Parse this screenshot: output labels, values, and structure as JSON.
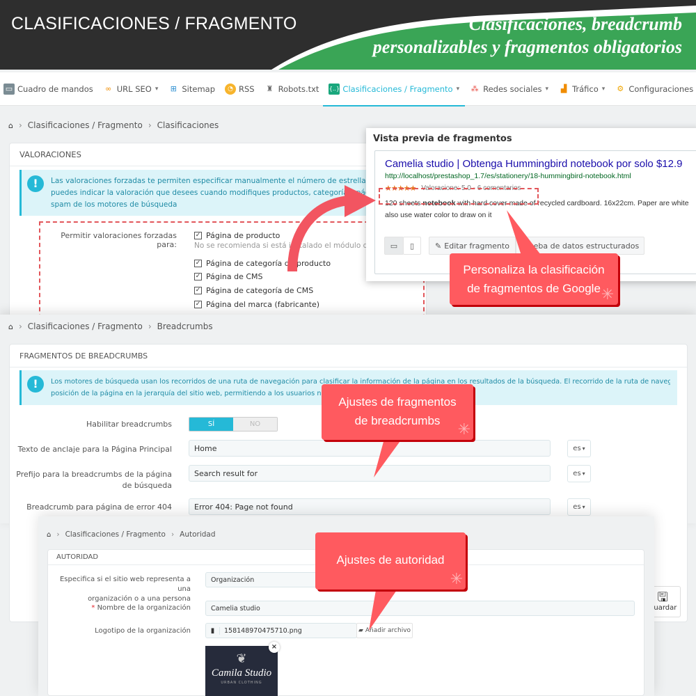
{
  "banner": {
    "title": "CLASIFICACIONES / FRAGMENTO",
    "tagline_line1": "Clasificaciones, breadcrumb",
    "tagline_line2": "personalizables y fragmentos obligatorios",
    "colors": {
      "dark": "#2e2e2e",
      "green": "#3aa556"
    }
  },
  "nav": {
    "items": [
      {
        "label": "Cuadro de mandos",
        "icon": "dashboard-icon",
        "dropdown": false
      },
      {
        "label": "URL SEO",
        "icon": "link-icon",
        "dropdown": true
      },
      {
        "label": "Sitemap",
        "icon": "sitemap-icon",
        "dropdown": false
      },
      {
        "label": "RSS",
        "icon": "rss-icon",
        "dropdown": false
      },
      {
        "label": "Robots.txt",
        "icon": "robot-icon",
        "dropdown": false
      },
      {
        "label": "Clasificaciones / Fragmento",
        "icon": "snippet-icon",
        "dropdown": true,
        "active": true
      },
      {
        "label": "Redes sociales",
        "icon": "share-icon",
        "dropdown": true
      },
      {
        "label": "Tráfico",
        "icon": "chart-icon",
        "dropdown": true
      },
      {
        "label": "Configuraciones",
        "icon": "gears-icon",
        "dropdown": true
      }
    ],
    "accent": "#25b9d7"
  },
  "ratings_panel": {
    "breadcrumb": [
      "Clasificaciones / Fragmento",
      "Clasificaciones"
    ],
    "card_title": "VALORACIONES",
    "alert_lines": [
      "Las valoraciones forzadas te permiten especificar manualmente el número de estrellas de valoració",
      "puedes indicar la valoración que desees cuando modifiques productos, categorías, páginas CM",
      "spam de los motores de búsqueda"
    ],
    "field_label": "Permitir valoraciones forzadas para:",
    "options": [
      {
        "label": "Página de producto",
        "checked": true
      },
      {
        "label": "Página de categoría de producto",
        "checked": true
      },
      {
        "label": "Página de CMS",
        "checked": true
      },
      {
        "label": "Página de categoría de CMS",
        "checked": true
      },
      {
        "label": "Página del marca (fabricante)",
        "checked": true
      }
    ],
    "hint": "No se recomienda si está instalado el módulo de \"Com"
  },
  "preview": {
    "heading": "Vista previa de fragmentos",
    "serp_title": "Camelia studio | Obtenga Hummingbird notebook por solo $12.9",
    "serp_url": "http://localhost/prestashop_1.7/es/stationery/18-hummingbird-notebook.html",
    "stars": "★★★★★",
    "rating_text": "Valoracione: 5.0 - 6 comentarios",
    "desc_pre": "120 sheets ",
    "desc_bold": "notebook",
    "desc_post": " with hard cover made of recycled cardboard. 16x22cm. Paper are white",
    "desc_line2": "also use water color to draw on it",
    "edit_button": "Editar fragmento",
    "test_button": "Prueba de datos estructurados"
  },
  "breadcrumbs_panel": {
    "breadcrumb": [
      "Clasificaciones / Fragmento",
      "Breadcrumbs"
    ],
    "card_title": "FRAGMENTOS DE BREADCRUMBS",
    "alert_line1": "Los motores de búsqueda usan los recorridos de una ruta de navegación para clasificar la información de la página en los resultados de la búsqueda. El recorrido de la ruta de navegación indica la",
    "alert_line2": "posición de la página en la jerarquía del sitio web, permitiendo a los usuarios navegar m",
    "enable_label": "Habilitar breadcrumbs",
    "switch_on": "SÍ",
    "switch_off": "NO",
    "fields": [
      {
        "label": "Texto de anclaje para la Página Principal",
        "value": "Home",
        "lang": "es"
      },
      {
        "label": "Prefijo para la breadcrumbs de la página de búsqueda",
        "value": "Search result for",
        "lang": "es"
      },
      {
        "label": "Breadcrumb para página de error 404",
        "value": "Error 404: Page not found",
        "lang": "es"
      }
    ],
    "save_label": "Guardar"
  },
  "authority_panel": {
    "breadcrumb": [
      "Clasificaciones / Fragmento",
      "Autoridad"
    ],
    "card_title": "AUTORIDAD",
    "type_label_1": "Especifica si el sitio web representa a una",
    "type_label_2": "organización o a una persona",
    "type_value": "Organización",
    "name_label": "Nombre de la organización",
    "name_value": "Camelia studio",
    "logo_label": "Logotipo de la organización",
    "logo_file": "158148970475710.png",
    "add_file": "Añadir archivo",
    "logo_text": "Camila Studio",
    "logo_sub": "URBAN CLOTHING"
  },
  "callouts": {
    "ratings": [
      "Personaliza la clasificación",
      "de fragmentos de Google"
    ],
    "breadcrumbs": [
      "Ajustes de fragmentos",
      "de breadcrumbs"
    ],
    "authority": "Ajustes de autoridad"
  }
}
